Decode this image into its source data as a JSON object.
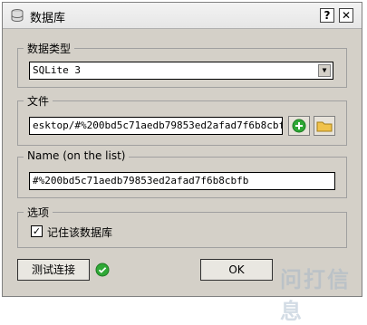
{
  "titlebar": {
    "title": "数据库",
    "help_label": "?",
    "close_label": "✕"
  },
  "db_type": {
    "legend": "数据类型",
    "selected": "SQLite 3"
  },
  "file": {
    "legend": "文件",
    "path_value": "esktop/#%200bd5c71aedb79853ed2afad7f6b8cbfb.db"
  },
  "name": {
    "legend": "Name (on the list)",
    "value": "#%200bd5c71aedb79853ed2afad7f6b8cbfb"
  },
  "options": {
    "legend": "选项",
    "remember_label": "记住该数据库",
    "remember_checked": true
  },
  "buttons": {
    "test_label": "测试连接",
    "ok_label": "OK"
  },
  "watermark": {
    "text": "问打信息"
  },
  "colors": {
    "dialog_bg": "#d4d0c8",
    "accent_green": "#2fa836"
  }
}
